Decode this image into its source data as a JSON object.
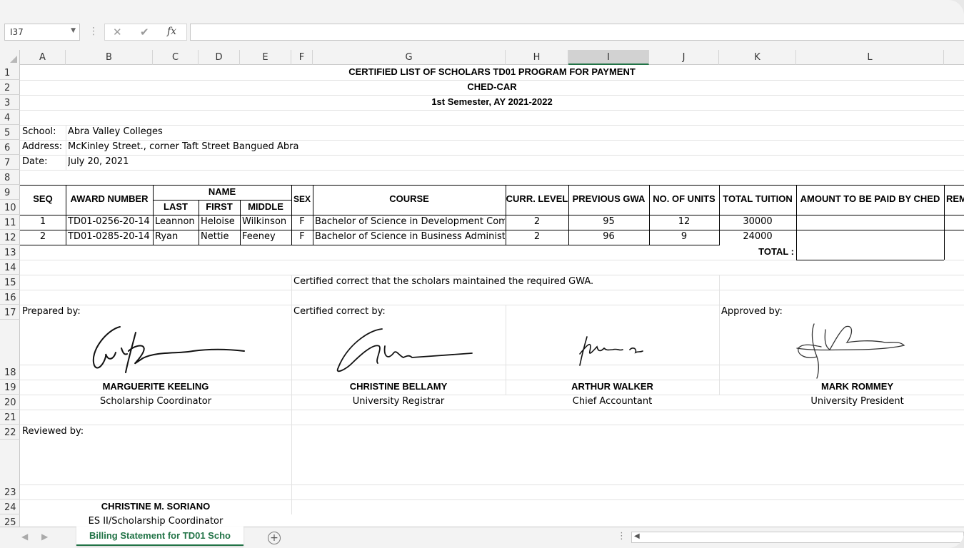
{
  "formula_bar": {
    "name_box": "I37",
    "formula": "",
    "cancel_icon": "✕",
    "enter_icon": "✔",
    "fx_label": "fx"
  },
  "columns": [
    "A",
    "B",
    "C",
    "D",
    "E",
    "F",
    "G",
    "H",
    "I",
    "J",
    "K",
    "L"
  ],
  "selected_column": "I",
  "rows": [
    "1",
    "2",
    "3",
    "4",
    "5",
    "6",
    "7",
    "8",
    "9",
    "10",
    "11",
    "12",
    "13",
    "14",
    "15",
    "16",
    "17",
    "18",
    "19",
    "20",
    "21",
    "22",
    "23",
    "24",
    "25"
  ],
  "sheet": {
    "title1": "CERTIFIED LIST OF SCHOLARS TD01 PROGRAM FOR PAYMENT",
    "title2": "CHED-CAR",
    "title3": "1st Semester, AY 2021-2022",
    "school_label": "School:",
    "school_value": "Abra Valley Colleges",
    "address_label": "Address:",
    "address_value": "McKinley Street., corner Taft Street Bangued Abra",
    "date_label": "Date:",
    "date_value": "July 20, 2021",
    "headers": {
      "seq": "SEQ",
      "award": "AWARD NUMBER",
      "name": "NAME",
      "last": "LAST",
      "first": "FIRST",
      "middle": "MIDDLE",
      "sex": "SEX",
      "course": "COURSE",
      "level": "CURR. LEVEL",
      "gwa": "PREVIOUS GWA",
      "units": "NO. OF UNITS",
      "tuition": "TOTAL TUITION",
      "ched": "AMOUNT TO BE PAID BY CHED",
      "rem": "REM"
    },
    "records": [
      {
        "seq": "1",
        "award": "TD01-0256-20-14",
        "last": "Leannon",
        "first": "Heloise",
        "middle": "Wilkinson",
        "sex": "F",
        "course": "Bachelor of Science in Development Com",
        "level": "2",
        "gwa": "95",
        "units": "12",
        "tuition": "30000"
      },
      {
        "seq": "2",
        "award": "TD01-0285-20-14",
        "last": "Ryan",
        "first": "Nettie",
        "middle": "Feeney",
        "sex": "F",
        "course": "Bachelor of Science in Business Administ",
        "level": "2",
        "gwa": "96",
        "units": "9",
        "tuition": "24000"
      }
    ],
    "total_label": "TOTAL :",
    "certified_note": "Certified correct that the scholars maintained the required GWA.",
    "prepared_by": "Prepared by:",
    "certified_by": "Certified correct by:",
    "approved_by": "Approved by:",
    "reviewed_by": "Reviewed by:",
    "signatories": [
      {
        "name": "MARGUERITE KEELING",
        "title": "Scholarship Coordinator"
      },
      {
        "name": "CHRISTINE BELLAMY",
        "title": "University Registrar"
      },
      {
        "name": "ARTHUR WALKER",
        "title": "Chief Accountant"
      },
      {
        "name": "MARK ROMMEY",
        "title": "University President"
      }
    ],
    "reviewer": {
      "name": "CHRISTINE M. SORIANO",
      "title": "ES II/Scholarship Coordinator"
    }
  },
  "tabs": {
    "active_sheet": "Billing Statement for TD01 Scho",
    "add_sheet": "+"
  },
  "colors": {
    "accent": "#217346"
  }
}
